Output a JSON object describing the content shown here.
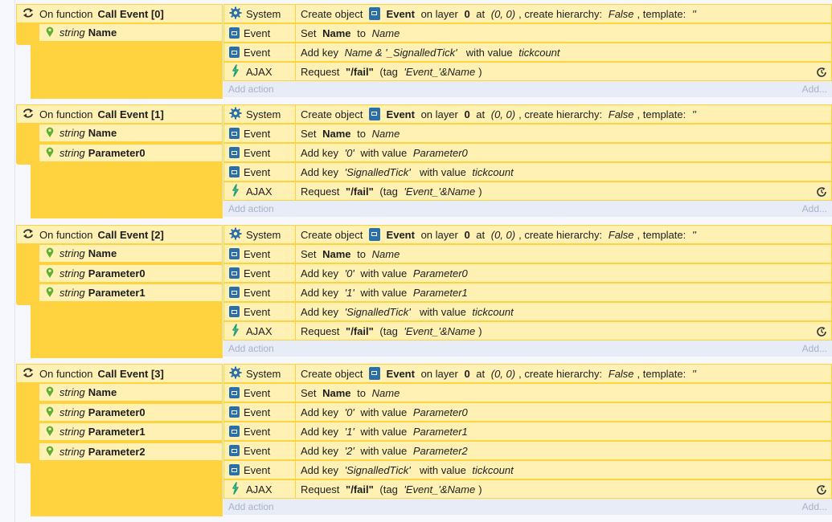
{
  "colors": {
    "accent": "#ffd240",
    "cell": "#fff1b3",
    "ajax": "#20a07a",
    "eventIcon": "#2a6fa8",
    "addActionText": "#a8b2c7"
  },
  "events": [
    {
      "prefix": "On function",
      "name": "Call Event [0]",
      "params": [
        {
          "type": "string",
          "name": "Name"
        }
      ],
      "actions": [
        {
          "object": "System",
          "icon": "gear-icon",
          "parts": [
            [
              "n",
              "Create object "
            ],
            [
              "icon",
              "event-object-icon"
            ],
            [
              "b",
              " Event"
            ],
            [
              "n",
              " on layer "
            ],
            [
              "b",
              "0"
            ],
            [
              "n",
              " at "
            ],
            [
              "i",
              "(0, 0)"
            ],
            [
              "n",
              ", create hierarchy: "
            ],
            [
              "i",
              "False"
            ],
            [
              "n",
              ", template: "
            ],
            [
              "i",
              "''"
            ]
          ]
        },
        {
          "object": "Event",
          "icon": "event-object-icon",
          "parts": [
            [
              "n",
              "Set "
            ],
            [
              "b",
              "Name"
            ],
            [
              "n",
              " to "
            ],
            [
              "i",
              "Name"
            ]
          ]
        },
        {
          "object": "Event",
          "icon": "event-object-icon",
          "parts": [
            [
              "n",
              "Add key "
            ],
            [
              "i",
              "Name & '_SignalledTick'"
            ],
            [
              "n",
              "  with value "
            ],
            [
              "i",
              "tickcount"
            ]
          ]
        },
        {
          "object": "AJAX",
          "icon": "ajax-icon",
          "spinner": true,
          "parts": [
            [
              "n",
              "Request "
            ],
            [
              "b",
              "\"/fail\""
            ],
            [
              "n",
              " (tag "
            ],
            [
              "i",
              "'Event_'&Name"
            ],
            [
              "n",
              ")"
            ]
          ]
        }
      ],
      "add_action": "Add action",
      "add_more": "Add..."
    },
    {
      "prefix": "On function",
      "name": "Call Event [1]",
      "params": [
        {
          "type": "string",
          "name": "Name"
        },
        {
          "type": "string",
          "name": "Parameter0"
        }
      ],
      "actions": [
        {
          "object": "System",
          "icon": "gear-icon",
          "parts": [
            [
              "n",
              "Create object "
            ],
            [
              "icon",
              "event-object-icon"
            ],
            [
              "b",
              " Event"
            ],
            [
              "n",
              " on layer "
            ],
            [
              "b",
              "0"
            ],
            [
              "n",
              " at "
            ],
            [
              "i",
              "(0, 0)"
            ],
            [
              "n",
              ", create hierarchy: "
            ],
            [
              "i",
              "False"
            ],
            [
              "n",
              ", template: "
            ],
            [
              "i",
              "''"
            ]
          ]
        },
        {
          "object": "Event",
          "icon": "event-object-icon",
          "parts": [
            [
              "n",
              "Set "
            ],
            [
              "b",
              "Name"
            ],
            [
              "n",
              " to "
            ],
            [
              "i",
              "Name"
            ]
          ]
        },
        {
          "object": "Event",
          "icon": "event-object-icon",
          "parts": [
            [
              "n",
              "Add key "
            ],
            [
              "i",
              "'0'"
            ],
            [
              "n",
              " with value "
            ],
            [
              "i",
              "Parameter0"
            ]
          ]
        },
        {
          "object": "Event",
          "icon": "event-object-icon",
          "parts": [
            [
              "n",
              "Add key "
            ],
            [
              "i",
              "'SignalledTick'"
            ],
            [
              "n",
              "  with value "
            ],
            [
              "i",
              "tickcount"
            ]
          ]
        },
        {
          "object": "AJAX",
          "icon": "ajax-icon",
          "spinner": true,
          "parts": [
            [
              "n",
              "Request "
            ],
            [
              "b",
              "\"/fail\""
            ],
            [
              "n",
              " (tag "
            ],
            [
              "i",
              "'Event_'&Name"
            ],
            [
              "n",
              ")"
            ]
          ]
        }
      ],
      "add_action": "Add action",
      "add_more": "Add..."
    },
    {
      "prefix": "On function",
      "name": "Call Event [2]",
      "params": [
        {
          "type": "string",
          "name": "Name"
        },
        {
          "type": "string",
          "name": "Parameter0"
        },
        {
          "type": "string",
          "name": "Parameter1"
        }
      ],
      "actions": [
        {
          "object": "System",
          "icon": "gear-icon",
          "parts": [
            [
              "n",
              "Create object "
            ],
            [
              "icon",
              "event-object-icon"
            ],
            [
              "b",
              " Event"
            ],
            [
              "n",
              " on layer "
            ],
            [
              "b",
              "0"
            ],
            [
              "n",
              " at "
            ],
            [
              "i",
              "(0, 0)"
            ],
            [
              "n",
              ", create hierarchy: "
            ],
            [
              "i",
              "False"
            ],
            [
              "n",
              ", template: "
            ],
            [
              "i",
              "''"
            ]
          ]
        },
        {
          "object": "Event",
          "icon": "event-object-icon",
          "parts": [
            [
              "n",
              "Set "
            ],
            [
              "b",
              "Name"
            ],
            [
              "n",
              " to "
            ],
            [
              "i",
              "Name"
            ]
          ]
        },
        {
          "object": "Event",
          "icon": "event-object-icon",
          "parts": [
            [
              "n",
              "Add key "
            ],
            [
              "i",
              "'0'"
            ],
            [
              "n",
              " with value "
            ],
            [
              "i",
              "Parameter0"
            ]
          ]
        },
        {
          "object": "Event",
          "icon": "event-object-icon",
          "parts": [
            [
              "n",
              "Add key "
            ],
            [
              "i",
              "'1'"
            ],
            [
              "n",
              " with value "
            ],
            [
              "i",
              "Parameter1"
            ]
          ]
        },
        {
          "object": "Event",
          "icon": "event-object-icon",
          "parts": [
            [
              "n",
              "Add key "
            ],
            [
              "i",
              "'SignalledTick'"
            ],
            [
              "n",
              "  with value "
            ],
            [
              "i",
              "tickcount"
            ]
          ]
        },
        {
          "object": "AJAX",
          "icon": "ajax-icon",
          "spinner": true,
          "parts": [
            [
              "n",
              "Request "
            ],
            [
              "b",
              "\"/fail\""
            ],
            [
              "n",
              " (tag "
            ],
            [
              "i",
              "'Event_'&Name"
            ],
            [
              "n",
              ")"
            ]
          ]
        }
      ],
      "add_action": "Add action",
      "add_more": "Add..."
    },
    {
      "prefix": "On function",
      "name": "Call Event [3]",
      "params": [
        {
          "type": "string",
          "name": "Name"
        },
        {
          "type": "string",
          "name": "Parameter0"
        },
        {
          "type": "string",
          "name": "Parameter1"
        },
        {
          "type": "string",
          "name": "Parameter2"
        }
      ],
      "actions": [
        {
          "object": "System",
          "icon": "gear-icon",
          "parts": [
            [
              "n",
              "Create object "
            ],
            [
              "icon",
              "event-object-icon"
            ],
            [
              "b",
              " Event"
            ],
            [
              "n",
              " on layer "
            ],
            [
              "b",
              "0"
            ],
            [
              "n",
              " at "
            ],
            [
              "i",
              "(0, 0)"
            ],
            [
              "n",
              ", create hierarchy: "
            ],
            [
              "i",
              "False"
            ],
            [
              "n",
              ", template: "
            ],
            [
              "i",
              "''"
            ]
          ]
        },
        {
          "object": "Event",
          "icon": "event-object-icon",
          "parts": [
            [
              "n",
              "Set "
            ],
            [
              "b",
              "Name"
            ],
            [
              "n",
              " to "
            ],
            [
              "i",
              "Name"
            ]
          ]
        },
        {
          "object": "Event",
          "icon": "event-object-icon",
          "parts": [
            [
              "n",
              "Add key "
            ],
            [
              "i",
              "'0'"
            ],
            [
              "n",
              " with value "
            ],
            [
              "i",
              "Parameter0"
            ]
          ]
        },
        {
          "object": "Event",
          "icon": "event-object-icon",
          "parts": [
            [
              "n",
              "Add key "
            ],
            [
              "i",
              "'1'"
            ],
            [
              "n",
              " with value "
            ],
            [
              "i",
              "Parameter1"
            ]
          ]
        },
        {
          "object": "Event",
          "icon": "event-object-icon",
          "parts": [
            [
              "n",
              "Add key "
            ],
            [
              "i",
              "'2'"
            ],
            [
              "n",
              " with value "
            ],
            [
              "i",
              "Parameter2"
            ]
          ]
        },
        {
          "object": "Event",
          "icon": "event-object-icon",
          "parts": [
            [
              "n",
              "Add key "
            ],
            [
              "i",
              "'SignalledTick'"
            ],
            [
              "n",
              "  with value "
            ],
            [
              "i",
              "tickcount"
            ]
          ]
        },
        {
          "object": "AJAX",
          "icon": "ajax-icon",
          "spinner": true,
          "parts": [
            [
              "n",
              "Request "
            ],
            [
              "b",
              "\"/fail\""
            ],
            [
              "n",
              " (tag "
            ],
            [
              "i",
              "'Event_'&Name"
            ],
            [
              "n",
              ")"
            ]
          ]
        }
      ],
      "add_action": "Add action",
      "add_more": "Add..."
    }
  ]
}
